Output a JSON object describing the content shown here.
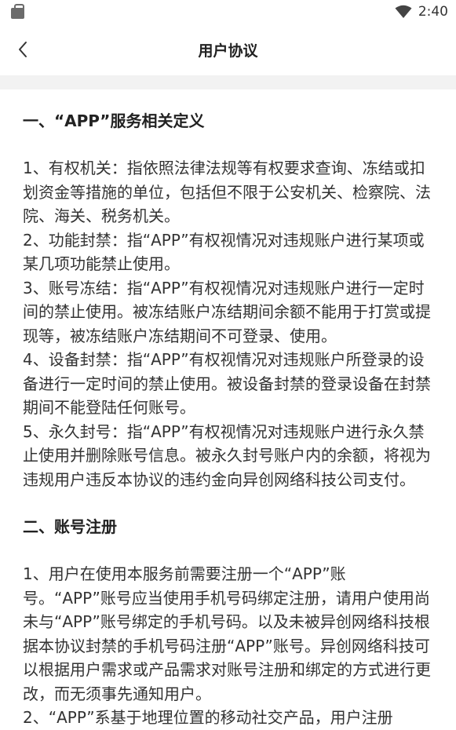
{
  "status_bar": {
    "time": "2:40",
    "left_icon": "shopping-bag-icon",
    "right_icon": "wifi-icon"
  },
  "nav": {
    "title": "用户协议",
    "back_icon": "chevron-left-icon"
  },
  "sections": [
    {
      "title": "一、“APP”服务相关定义",
      "body": "1、有权机关：指依照法律法规等有权要求查询、冻结或扣划资金等措施的单位，包括但不限于公安机关、检察院、法院、海关、税务机关。\n2、功能封禁：指“APP”有权视情况对违规账户进行某项或某几项功能禁止使用。\n3、账号冻结：指“APP”有权视情况对违规账户进行一定时间的禁止使用。被冻结账户冻结期间余额不能用于打赏或提现等，被冻结账户冻结期间不可登录、使用。\n4、设备封禁：指“APP”有权视情况对违规账户所登录的设备进行一定时间的禁止使用。被设备封禁的登录设备在封禁期间不能登陆任何账号。\n5、永久封号：指“APP”有权视情况对违规账户进行永久禁止使用并删除账号信息。被永久封号账户内的余额，将视为违规用户违反本协议的违约金向异创网络科技公司支付。"
    },
    {
      "title": "二、账号注册",
      "body": "1、用户在使用本服务前需要注册一个“APP”账号。“APP”账号应当使用手机号码绑定注册，请用户使用尚未与“APP”账号绑定的手机号码。以及未被异创网络科技根据本协议封禁的手机号码注册“APP”账号。异创网络科技可以根据用户需求或产品需求对账号注册和绑定的方式进行更改，而无须事先通知用户。\n2、“APP”系基于地理位置的移动社交产品，用户注册"
    }
  ],
  "colors": {
    "text": "#333333",
    "title": "#222222",
    "divider": "#f2f2f2",
    "background": "#ffffff"
  }
}
